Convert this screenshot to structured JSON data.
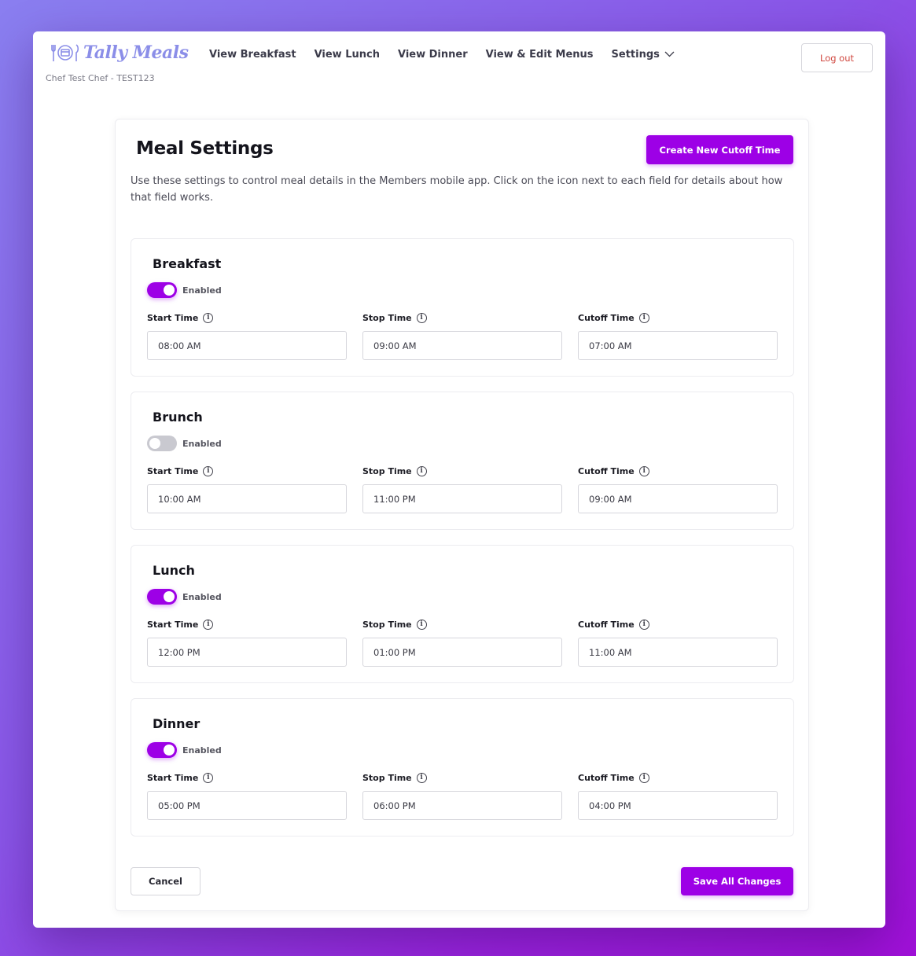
{
  "header": {
    "logo_text": "Tally Meals",
    "chef_label": "Chef Test Chef - TEST123",
    "nav": [
      {
        "label": "View Breakfast"
      },
      {
        "label": "View Lunch"
      },
      {
        "label": "View Dinner"
      },
      {
        "label": "View & Edit Menus"
      },
      {
        "label": "Settings"
      }
    ],
    "logout_label": "Log out"
  },
  "page": {
    "title": "Meal Settings",
    "create_button": "Create New Cutoff Time",
    "description": "Use these settings to control meal details in the Members mobile app. Click on the icon next to each field for details about how that field works.",
    "enabled_label": "Enabled",
    "start_label": "Start Time",
    "stop_label": "Stop Time",
    "cutoff_label": "Cutoff Time",
    "cancel_label": "Cancel",
    "save_label": "Save All Changes"
  },
  "meals": [
    {
      "name": "Breakfast",
      "enabled": true,
      "start": "08:00 AM",
      "stop": "09:00 AM",
      "cutoff": "07:00 AM"
    },
    {
      "name": "Brunch",
      "enabled": false,
      "start": "10:00 AM",
      "stop": "11:00 PM",
      "cutoff": "09:00 AM"
    },
    {
      "name": "Lunch",
      "enabled": true,
      "start": "12:00 PM",
      "stop": "01:00 PM",
      "cutoff": "11:00 AM"
    },
    {
      "name": "Dinner",
      "enabled": true,
      "start": "05:00 PM",
      "stop": "06:00 PM",
      "cutoff": "04:00 PM"
    }
  ],
  "colors": {
    "accent": "#9d00e6",
    "logo": "#8b8ee8",
    "logout_text": "#d0473f",
    "toggle_off": "#c9c9d0"
  },
  "icons": {
    "logo": "fork-plate-knife-icon",
    "settings_caret": "chevron-down-icon",
    "info": "info-icon"
  }
}
